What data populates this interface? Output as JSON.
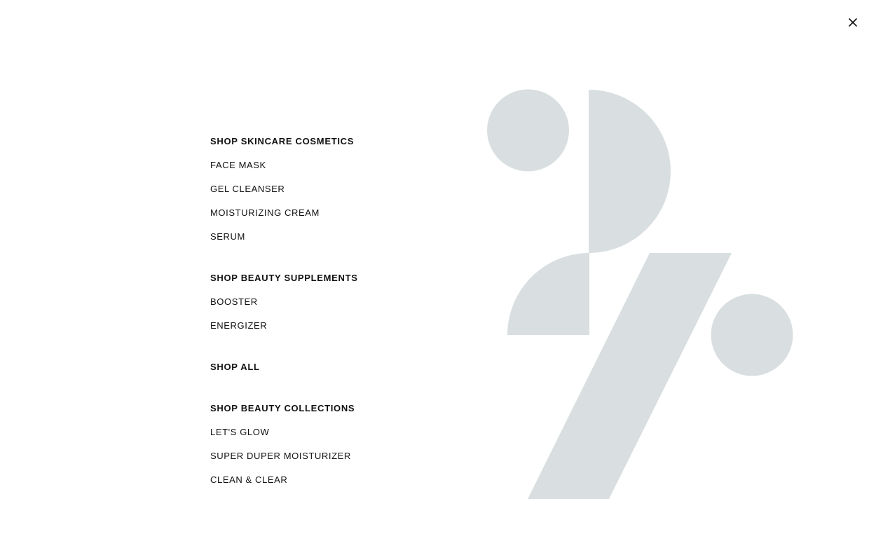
{
  "close_button": {
    "icon": "close-icon",
    "label": "Close menu"
  },
  "menu": {
    "skincare": {
      "heading": "SHOP SKINCARE COSMETICS",
      "items": [
        "FACE MASK",
        "GEL CLEANSER",
        "MOISTURIZING CREAM",
        "SERUM"
      ]
    },
    "supplements": {
      "heading": "SHOP BEAUTY SUPPLEMENTS",
      "items": [
        "BOOSTER",
        "ENERGIZER"
      ]
    },
    "shop_all": {
      "heading": "SHOP ALL"
    },
    "collections": {
      "heading": "SHOP BEAUTY COLLECTIONS",
      "items": [
        "LET'S GLOW",
        "SUPER DUPER MOISTURIZER",
        "CLEAN & CLEAR"
      ]
    }
  },
  "colors": {
    "text": "#111111",
    "background": "#ffffff",
    "graphic": "#d9dfe0"
  },
  "graphic": {
    "icon": "brand-percent-graphic"
  }
}
